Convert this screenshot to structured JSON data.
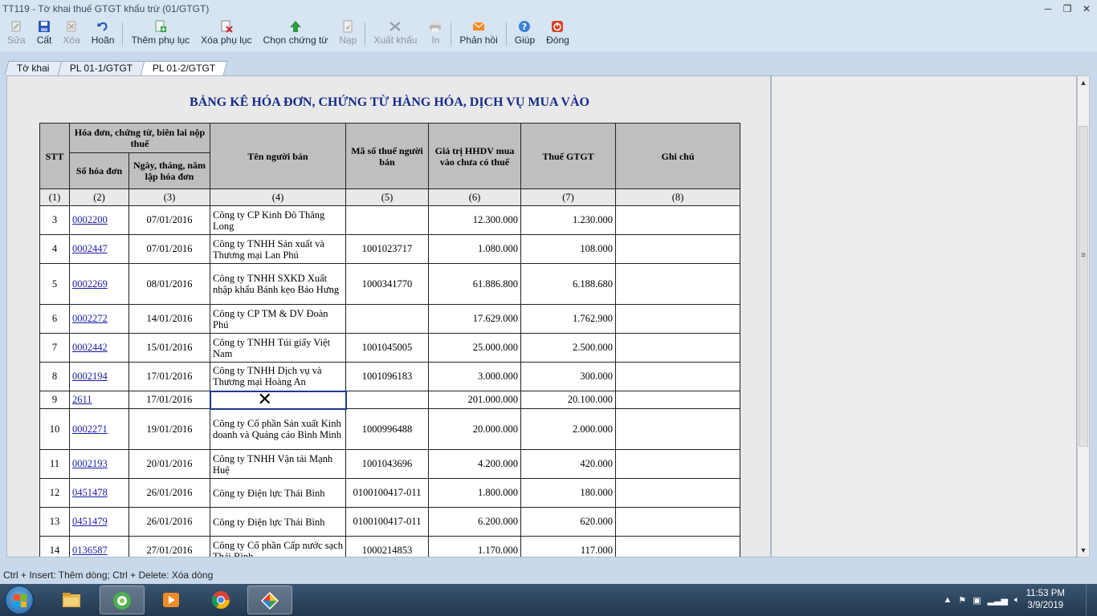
{
  "window": {
    "title": "TT119 - Tờ khai thuế GTGT khấu trừ (01/GTGT)"
  },
  "toolbar": {
    "items": [
      {
        "label": "Sửa",
        "icon": "edit-icon",
        "enabled": false
      },
      {
        "label": "Cất",
        "icon": "save-icon",
        "enabled": true
      },
      {
        "label": "Xóa",
        "icon": "delete-icon",
        "enabled": false
      },
      {
        "label": "Hoãn",
        "icon": "undo-icon",
        "enabled": true
      },
      {
        "label": "Thêm phụ lục",
        "icon": "add-appendix-icon",
        "enabled": true
      },
      {
        "label": "Xóa phụ lục",
        "icon": "remove-appendix-icon",
        "enabled": true
      },
      {
        "label": "Chọn chứng từ",
        "icon": "select-voucher-icon",
        "enabled": true
      },
      {
        "label": "Nạp",
        "icon": "load-icon",
        "enabled": false
      },
      {
        "label": "Xuất khẩu",
        "icon": "export-icon",
        "enabled": false
      },
      {
        "label": "In",
        "icon": "print-icon",
        "enabled": false
      },
      {
        "label": "Phản hồi",
        "icon": "feedback-icon",
        "enabled": true
      },
      {
        "label": "Giúp",
        "icon": "help-icon",
        "enabled": true
      },
      {
        "label": "Đóng",
        "icon": "close-icon",
        "enabled": true
      }
    ]
  },
  "tabs": [
    {
      "label": "Tờ khai",
      "active": false
    },
    {
      "label": "PL 01-1/GTGT",
      "active": false
    },
    {
      "label": "PL 01-2/GTGT",
      "active": true
    }
  ],
  "sheet": {
    "title": "BẢNG KÊ HÓA ĐƠN, CHỨNG TỪ HÀNG HÓA, DỊCH VỤ MUA VÀO",
    "headers": {
      "stt": "STT",
      "invoice_group": "Hóa đơn, chứng từ, biên lai nộp thuế",
      "invoice_no": "Số hóa đơn",
      "invoice_date": "Ngày, tháng, năm lập hóa đơn",
      "seller_name": "Tên người bán",
      "seller_tax_id": "Mã số thuế người bán",
      "value_before_tax": "Giá trị HHDV mua vào chưa có thuế",
      "vat": "Thuế GTGT",
      "note": "Ghi chú"
    },
    "column_index": [
      "(1)",
      "(2)",
      "(3)",
      "(4)",
      "(5)",
      "(6)",
      "(7)",
      "(8)"
    ],
    "rows": [
      {
        "stt": "3",
        "invoice_no": "0002200",
        "date": "07/01/2016",
        "seller": "Công ty CP Kinh Đô Thăng Long",
        "tax_id": "",
        "value": "12.300.000",
        "vat": "1.230.000",
        "note": ""
      },
      {
        "stt": "4",
        "invoice_no": "0002447",
        "date": "07/01/2016",
        "seller": "Công ty TNHH Sản xuất và Thương mại Lan Phú",
        "tax_id": "1001023717",
        "value": "1.080.000",
        "vat": "108.000",
        "note": ""
      },
      {
        "stt": "5",
        "invoice_no": "0002269",
        "date": "08/01/2016",
        "seller": "Công ty TNHH SXKD Xuất nhập khẩu Bánh kẹo Bảo Hưng",
        "tax_id": "1000341770",
        "value": "61.886.800",
        "vat": "6.188.680",
        "note": ""
      },
      {
        "stt": "6",
        "invoice_no": "0002272",
        "date": "14/01/2016",
        "seller": "Công ty CP TM & DV Đoàn Phú",
        "tax_id": "",
        "value": "17.629.000",
        "vat": "1.762.900",
        "note": ""
      },
      {
        "stt": "7",
        "invoice_no": "0002442",
        "date": "15/01/2016",
        "seller": "Công ty TNHH Túi giấy Việt Nam",
        "tax_id": "1001045005",
        "value": "25.000.000",
        "vat": "2.500.000",
        "note": ""
      },
      {
        "stt": "8",
        "invoice_no": "0002194",
        "date": "17/01/2016",
        "seller": "Công ty TNHH Dịch vụ và Thương mại Hoàng An",
        "tax_id": "1001096183",
        "value": "3.000.000",
        "vat": "300.000",
        "note": ""
      },
      {
        "stt": "9",
        "invoice_no": "2611",
        "date": "17/01/2016",
        "seller": "",
        "tax_id": "",
        "value": "201.000.000",
        "vat": "20.100.000",
        "note": ""
      },
      {
        "stt": "10",
        "invoice_no": "0002271",
        "date": "19/01/2016",
        "seller": "Công ty Cổ phần Sản xuất Kinh doanh và Quảng cáo Bình Minh",
        "tax_id": "1000996488",
        "value": "20.000.000",
        "vat": "2.000.000",
        "note": ""
      },
      {
        "stt": "11",
        "invoice_no": "0002193",
        "date": "20/01/2016",
        "seller": "Công ty TNHH Vận tải Mạnh Huệ",
        "tax_id": "1001043696",
        "value": "4.200.000",
        "vat": "420.000",
        "note": ""
      },
      {
        "stt": "12",
        "invoice_no": "0451478",
        "date": "26/01/2016",
        "seller": "Công ty Điện lực Thái Bình",
        "tax_id": "0100100417-011",
        "value": "1.800.000",
        "vat": "180.000",
        "note": ""
      },
      {
        "stt": "13",
        "invoice_no": "0451479",
        "date": "26/01/2016",
        "seller": "Công ty Điện lực Thái Bình",
        "tax_id": "0100100417-011",
        "value": "6.200.000",
        "vat": "620.000",
        "note": ""
      },
      {
        "stt": "14",
        "invoice_no": "0136587",
        "date": "27/01/2016",
        "seller": "Công ty Cổ phần Cấp nước sạch Thái Bình",
        "tax_id": "1000214853",
        "value": "1.170.000",
        "vat": "117.000",
        "note": ""
      }
    ]
  },
  "statusbar": {
    "hint": "Ctrl + Insert: Thêm dòng; Ctrl + Delete: Xóa dòng"
  },
  "taskbar": {
    "apps": [
      "file-explorer-icon",
      "coc-coc-browser-icon",
      "media-player-icon",
      "chrome-icon",
      "tax-app-icon"
    ],
    "clock_time": "11:53 PM",
    "clock_date": "3/9/2019"
  }
}
